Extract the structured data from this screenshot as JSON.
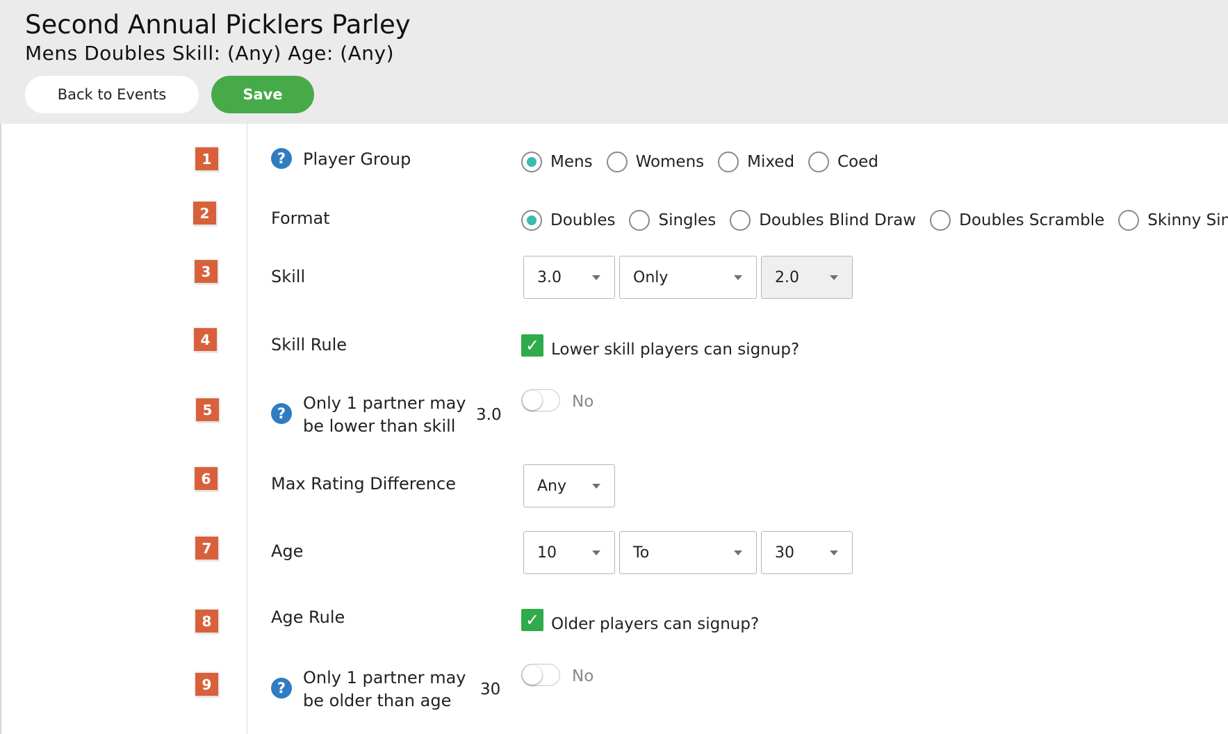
{
  "header": {
    "title": "Second Annual Picklers Parley",
    "subtitle": "Mens Doubles Skill: (Any) Age: (Any)",
    "back_label": "Back to Events",
    "save_label": "Save"
  },
  "rows": {
    "player_group": {
      "number": "1",
      "label": "Player Group",
      "options": [
        "Mens",
        "Womens",
        "Mixed",
        "Coed"
      ],
      "selected": "Mens"
    },
    "format": {
      "number": "2",
      "label": "Format",
      "options": [
        "Doubles",
        "Singles",
        "Doubles Blind Draw",
        "Doubles Scramble",
        "Skinny Singles"
      ],
      "selected": "Doubles"
    },
    "skill": {
      "number": "3",
      "label": "Skill",
      "value": "3.0",
      "mode": "Only",
      "max": "2.0"
    },
    "skill_rule": {
      "number": "4",
      "label": "Skill Rule",
      "checkbox_label": "Lower skill players can signup?",
      "checked": true
    },
    "partner_lower": {
      "number": "5",
      "label_line1": "Only 1 partner may",
      "label_line2": "be lower than skill",
      "value": "3.0",
      "toggle_text": "No"
    },
    "max_rating": {
      "number": "6",
      "label": "Max Rating Difference",
      "value": "Any"
    },
    "age": {
      "number": "7",
      "label": "Age",
      "from": "10",
      "mode": "To",
      "to": "30"
    },
    "age_rule": {
      "number": "8",
      "label": "Age Rule",
      "checkbox_label": "Older players can signup?",
      "checked": true
    },
    "partner_older": {
      "number": "9",
      "label_line1": "Only 1 partner may",
      "label_line2": "be older than age",
      "value": "30",
      "toggle_text": "No"
    }
  },
  "icons": {
    "help": "question-circle-icon",
    "check": "checkmark-icon",
    "caret": "caret-down-icon"
  },
  "colors": {
    "header_bg": "#ebebeb",
    "save_green": "#46aa49",
    "badge_orange": "#d8613c",
    "help_blue": "#2f7cc1",
    "radio_teal": "#3dbab0",
    "checkbox_green": "#2fab4b"
  }
}
